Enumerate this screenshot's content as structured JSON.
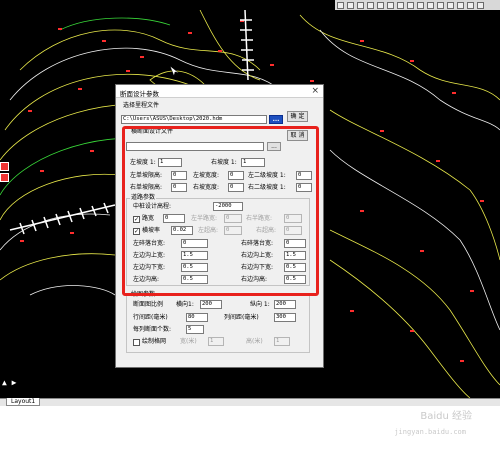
{
  "colors": {
    "cad_background": "#000000",
    "highlight_border": "#e8211c",
    "browse_button": "#1d4fbf"
  },
  "icons": {
    "window_close": "×",
    "browse": "...",
    "checked": "✓"
  },
  "layout_tab": {
    "label": "Layout1"
  },
  "axis_icon": {
    "label": "▲ ▶"
  },
  "watermark": {
    "text": "Baidu 经验",
    "url": "jingyan.baidu.com"
  },
  "dialog": {
    "title": "断面设计参数",
    "close_symbol": "×",
    "select_mileage_label": "选择里程文件",
    "mileage_file_path": "C:\\Users\\ASUS\\Desktop\\2020.hdm",
    "ok_button": "确 定",
    "cancel_button": "取 消",
    "cross_section_file_label": "横断面设计文件",
    "cross_section_file_value": "",
    "left_slope_label": "左坡度 1:",
    "left_slope_value": "1",
    "right_slope_label": "右坡度 1:",
    "right_slope_value": "1",
    "left_single_limit_label": "左单坡限高:",
    "left_single_limit_value": "0",
    "left_platform_width_label": "左坡宽度:",
    "left_platform_width_value": "0",
    "left_second_slope_label": "左二级坡度 1:",
    "left_second_slope_value": "0",
    "right_single_limit_label": "右单坡限高:",
    "right_single_limit_value": "0",
    "right_platform_width_label": "右坡宽度:",
    "right_platform_width_value": "0",
    "right_second_slope_label": "右二级坡度 1:",
    "right_second_slope_value": "0",
    "road_params_group": "道路参数",
    "center_elev_label": "中桩设计高程:",
    "center_elev_value": "-2000",
    "road_width_label": "路宽",
    "road_width_value": "0",
    "left_half_width_label": "左半路宽:",
    "left_half_width_value": "0",
    "right_half_width_label": "右半路宽:",
    "right_half_width_value": "0",
    "crown_slope_label": "横坡率",
    "crown_slope_value": "0.02",
    "left_superelev_label": "左超高:",
    "left_superelev_value": "0",
    "right_superelev_label": "右超高:",
    "right_superelev_value": "0",
    "left_berm_width_label": "左碎落台宽:",
    "left_berm_width_value": "0",
    "right_berm_width_label": "右碎落台宽:",
    "right_berm_width_value": "0",
    "left_ditch_top_label": "左边沟上宽:",
    "left_ditch_top_value": "1.5",
    "right_ditch_top_label": "右边沟上宽:",
    "right_ditch_top_value": "1.5",
    "left_ditch_bottom_label": "左边沟下宽:",
    "left_ditch_bottom_value": "0.5",
    "right_ditch_bottom_label": "右边沟下宽:",
    "right_ditch_bottom_value": "0.5",
    "left_ditch_depth_label": "左边沟高:",
    "left_ditch_depth_value": "0.5",
    "right_ditch_depth_label": "右边沟高:",
    "right_ditch_depth_value": "0.5",
    "plot_params_group": "绘图参数",
    "scale_label": "断面图比例",
    "scale_h_label": "横向1:",
    "scale_h_value": "200",
    "scale_v_label": "纵向 1:",
    "scale_v_value": "200",
    "row_spacing_label": "行间距(毫米)",
    "row_spacing_value": "80",
    "col_spacing_label": "列间距(毫米)",
    "col_spacing_value": "300",
    "per_column_label": "每列断面个数:",
    "per_column_value": "5",
    "draw_grid_label": "绘制格网",
    "grid_width_label": "宽(米)",
    "grid_width_value": "1",
    "grid_height_label": "高(米)",
    "grid_height_value": "1"
  }
}
